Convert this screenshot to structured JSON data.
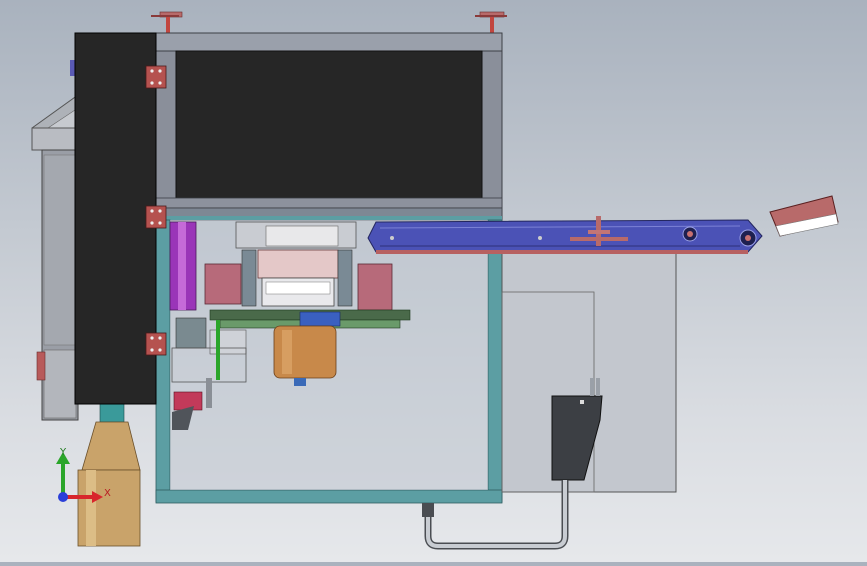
{
  "viewport": {
    "background_top": "#a9b2be",
    "background_bottom": "#e6e8eb"
  },
  "triad": {
    "x_label": "X",
    "y_label": "Y",
    "x_color": "#d8262c",
    "y_color": "#2aa52a",
    "z_color": "#2a3fd8"
  },
  "colors": {
    "door_panel": "#262626",
    "frame_teal": "#5c9ea3",
    "frame_gray": "#8a8f9a",
    "conveyor_blue": "#4b52b6",
    "feed_cone": "#c9a36a",
    "bucket_copper": "#c8894a",
    "hinge_red": "#b5524f",
    "cabinet_gray": "#9a9ea6"
  }
}
